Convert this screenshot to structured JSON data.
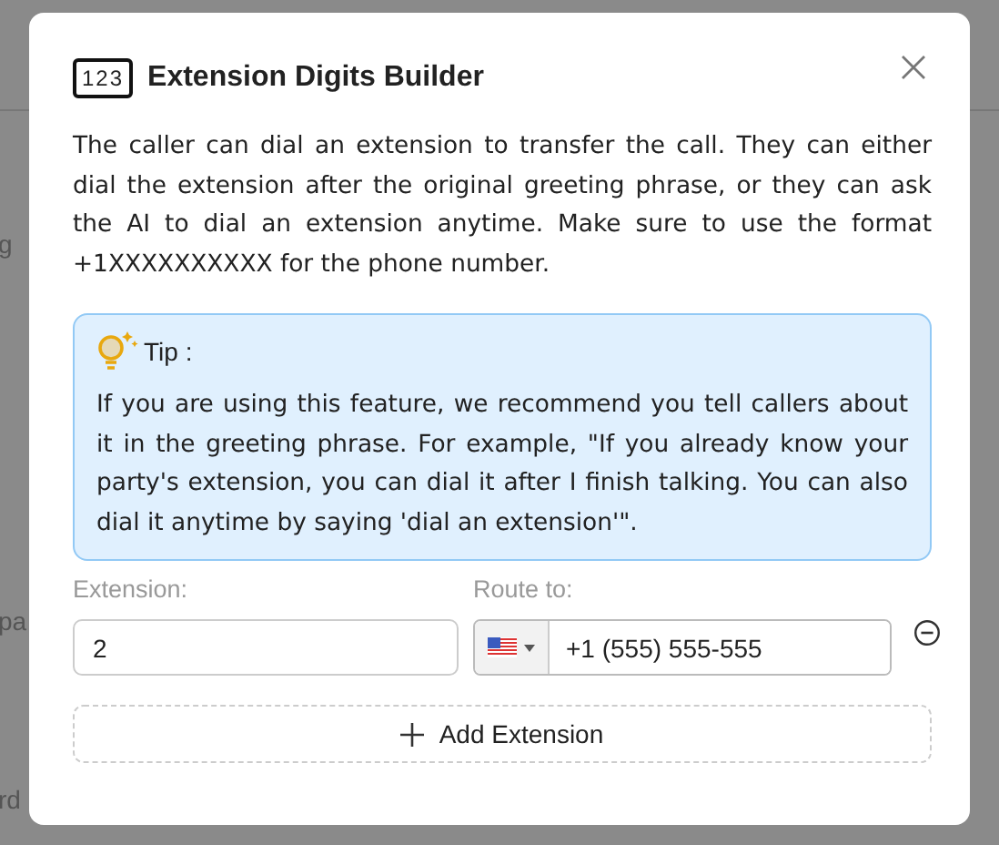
{
  "backdrop": {
    "texts": [
      "g",
      "pa",
      "rd"
    ]
  },
  "dialog": {
    "icon_text": "123",
    "title": "Extension Digits Builder",
    "description": "The caller can dial an extension to transfer the call. They can either dial the extension after the original greeting phrase, or they can ask the AI to dial an extension anytime. Make sure to use the format +1XXXXXXXXXX for the phone number.",
    "tip": {
      "label": "Tip :",
      "text": "If you are using this feature, we recommend you tell callers about it in the greeting phrase. For example, \"If you already know your party's extension, you can dial it after I finish talking. You can also dial it anytime by saying 'dial an extension'\"."
    },
    "columns": [
      "Extension:",
      "Route to:"
    ],
    "rows": [
      {
        "extension": "2",
        "route": "+1 (555) 555-555"
      }
    ],
    "add_button": "Add Extension"
  }
}
